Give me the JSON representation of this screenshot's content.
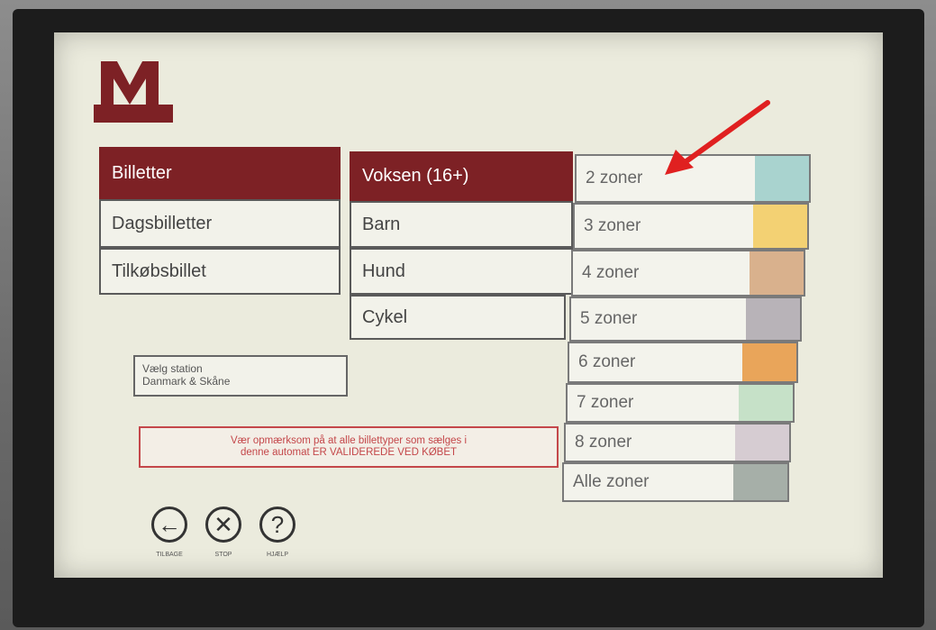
{
  "categories": [
    {
      "label": "Billetter",
      "selected": true
    },
    {
      "label": "Dagsbilletter",
      "selected": false
    },
    {
      "label": "Tilkøbsbillet",
      "selected": false
    }
  ],
  "passengers": [
    {
      "label": "Voksen (16+)",
      "selected": true
    },
    {
      "label": "Barn",
      "selected": false
    },
    {
      "label": "Hund",
      "selected": false
    },
    {
      "label": "Cykel",
      "selected": false
    }
  ],
  "zones": [
    {
      "label": "2 zoner",
      "color": "#a9d3cf"
    },
    {
      "label": "3 zoner",
      "color": "#f3d173"
    },
    {
      "label": "4 zoner",
      "color": "#d9b18d"
    },
    {
      "label": "5 zoner",
      "color": "#b8b3b8"
    },
    {
      "label": "6 zoner",
      "color": "#e9a55a"
    },
    {
      "label": "7 zoner",
      "color": "#c6e1c8"
    },
    {
      "label": "8 zoner",
      "color": "#d6ccd2"
    },
    {
      "label": "Alle zoner",
      "color": "#a6afa8"
    }
  ],
  "station": {
    "line1": "Vælg station",
    "line2": "Danmark & Skåne"
  },
  "notice": {
    "line1": "Vær opmærksom på at alle billettyper som sælges i",
    "line2": "denne automat ER VALIDEREDE VED KØBET"
  },
  "nav": {
    "back_label": "TILBAGE",
    "stop_label": "STOP",
    "help_label": "HJÆLP",
    "back_glyph": "←",
    "stop_glyph": "✕",
    "help_glyph": "?"
  },
  "colors": {
    "brand": "#7d2125",
    "arrow": "#e02020"
  }
}
